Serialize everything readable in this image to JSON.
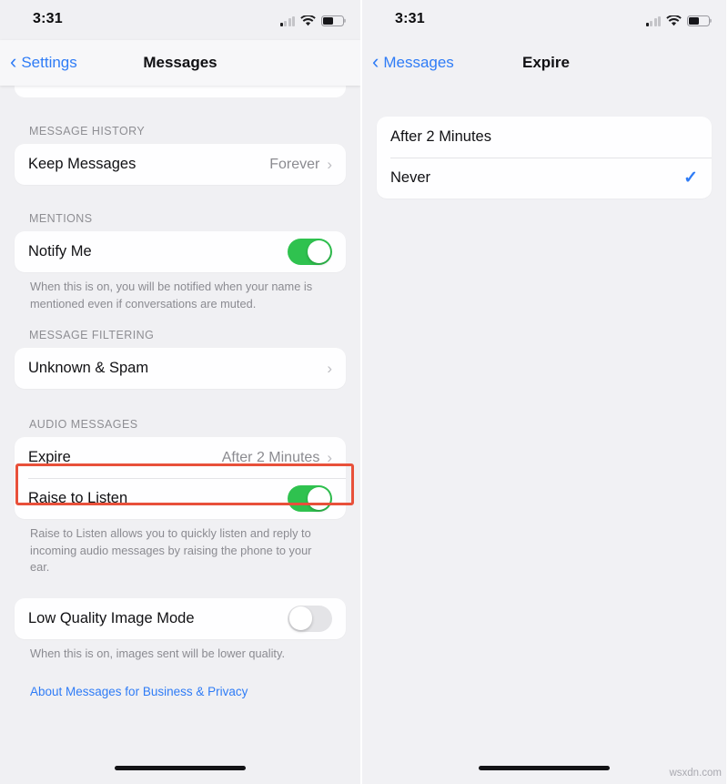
{
  "watermark": "wsxdn.com",
  "colors": {
    "accent_blue": "#2f7cf6",
    "toggle_on_green": "#2fc24f",
    "highlight_red": "#e8503a",
    "background": "#f0f0f3",
    "card": "#fefeff"
  },
  "left": {
    "status": {
      "time": "3:31",
      "signal_icon": "cellular-signal-icon",
      "wifi_icon": "wifi-icon",
      "battery_icon": "battery-icon"
    },
    "nav": {
      "back_label": "Settings",
      "title": "Messages"
    },
    "sections": {
      "message_history": {
        "label": "MESSAGE HISTORY",
        "rows": [
          {
            "label": "Keep Messages",
            "value": "Forever"
          }
        ]
      },
      "mentions": {
        "label": "MENTIONS",
        "rows": [
          {
            "label": "Notify Me",
            "toggle": "on"
          }
        ],
        "footnote": "When this is on, you will be notified when your name is mentioned even if conversations are muted."
      },
      "message_filtering": {
        "label": "MESSAGE FILTERING",
        "rows": [
          {
            "label": "Unknown & Spam"
          }
        ]
      },
      "audio_messages": {
        "label": "AUDIO MESSAGES",
        "rows": [
          {
            "label": "Expire",
            "value": "After 2 Minutes"
          },
          {
            "label": "Raise to Listen",
            "toggle": "on"
          }
        ],
        "footnote": "Raise to Listen allows you to quickly listen and reply to incoming audio messages by raising the phone to your ear."
      },
      "image_mode": {
        "rows": [
          {
            "label": "Low Quality Image Mode",
            "toggle": "off"
          }
        ],
        "footnote": "When this is on, images sent will be lower quality."
      }
    },
    "about_link": "About Messages for Business & Privacy"
  },
  "right": {
    "status": {
      "time": "3:31",
      "signal_icon": "cellular-signal-icon",
      "wifi_icon": "wifi-icon",
      "battery_icon": "battery-icon"
    },
    "nav": {
      "back_label": "Messages",
      "title": "Expire"
    },
    "options": [
      {
        "label": "After 2 Minutes",
        "selected": false
      },
      {
        "label": "Never",
        "selected": true,
        "check": "✓"
      }
    ]
  }
}
